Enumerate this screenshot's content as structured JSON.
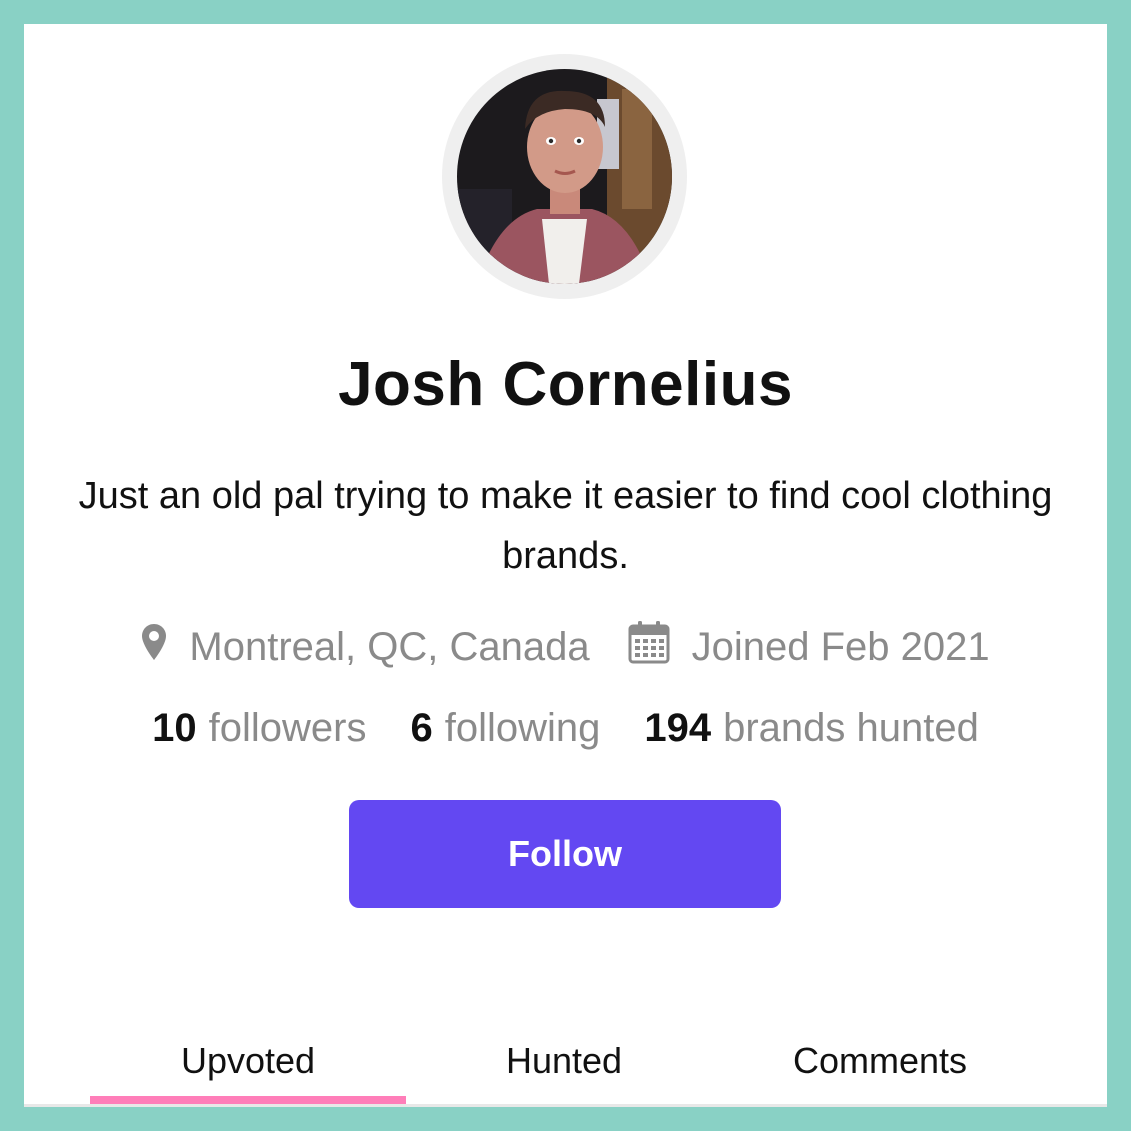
{
  "profile": {
    "name": "Josh Cornelius",
    "bio": "Just an old pal trying to make it easier to find cool clothing brands.",
    "location": "Montreal, QC, Canada",
    "joined": "Joined Feb 2021",
    "location_icon": "map-pin-icon",
    "joined_icon": "calendar-icon"
  },
  "stats": [
    {
      "count": "10",
      "label": "followers"
    },
    {
      "count": "6",
      "label": "following"
    },
    {
      "count": "194",
      "label": "brands hunted"
    }
  ],
  "actions": {
    "follow_label": "Follow"
  },
  "tabs": [
    {
      "label": "Upvoted",
      "active": true
    },
    {
      "label": "Hunted",
      "active": false
    },
    {
      "label": "Comments",
      "active": false
    }
  ],
  "colors": {
    "background": "#89d1c5",
    "accent": "#6348f2",
    "tab_underline": "#ff7eb9",
    "muted_text": "#8a8a8a"
  }
}
